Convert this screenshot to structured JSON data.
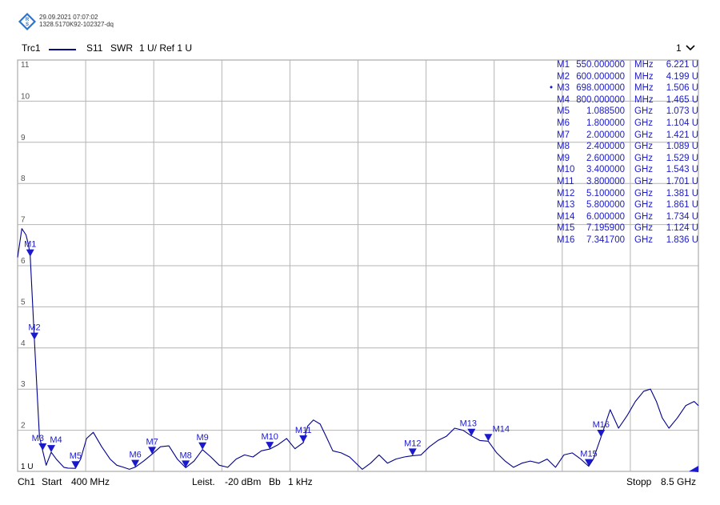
{
  "header": {
    "timestamp": "29.09.2021 07:07:02",
    "instrument_id": "1328.5170K92-102327-dq",
    "logo_icon": "rohde-schwarz-logo"
  },
  "trace": {
    "name": "Trc1",
    "parameter": "S11",
    "format": "SWR",
    "scale": "1 U/ Ref 1 U",
    "color": "#00008b",
    "channel_selector": "1"
  },
  "footer": {
    "channel": "Ch1",
    "start_label": "Start",
    "start_value": "400 MHz",
    "power_label": "Leist.",
    "power_value": "-20 dBm",
    "bw_label": "Bb",
    "bw_value": "1 kHz",
    "stop_label": "Stopp",
    "stop_value": "8.5 GHz"
  },
  "colors": {
    "trace": "#00008b",
    "marker": "#1a1acc",
    "grid": "#b4b4b4",
    "background": "#ffffff"
  },
  "markers": [
    {
      "name": "M1",
      "freq": "550.000000",
      "unit": "MHz",
      "value": "6.221",
      "vunit": "U",
      "active": false
    },
    {
      "name": "M2",
      "freq": "600.000000",
      "unit": "MHz",
      "value": "4.199",
      "vunit": "U",
      "active": false
    },
    {
      "name": "M3",
      "freq": "698.000000",
      "unit": "MHz",
      "value": "1.506",
      "vunit": "U",
      "active": true
    },
    {
      "name": "M4",
      "freq": "800.000000",
      "unit": "MHz",
      "value": "1.465",
      "vunit": "U",
      "active": false
    },
    {
      "name": "M5",
      "freq": "1.088500",
      "unit": "GHz",
      "value": "1.073",
      "vunit": "U",
      "active": false
    },
    {
      "name": "M6",
      "freq": "1.800000",
      "unit": "GHz",
      "value": "1.104",
      "vunit": "U",
      "active": false
    },
    {
      "name": "M7",
      "freq": "2.000000",
      "unit": "GHz",
      "value": "1.421",
      "vunit": "U",
      "active": false
    },
    {
      "name": "M8",
      "freq": "2.400000",
      "unit": "GHz",
      "value": "1.089",
      "vunit": "U",
      "active": false
    },
    {
      "name": "M9",
      "freq": "2.600000",
      "unit": "GHz",
      "value": "1.529",
      "vunit": "U",
      "active": false
    },
    {
      "name": "M10",
      "freq": "3.400000",
      "unit": "GHz",
      "value": "1.543",
      "vunit": "U",
      "active": false
    },
    {
      "name": "M11",
      "freq": "3.800000",
      "unit": "GHz",
      "value": "1.701",
      "vunit": "U",
      "active": false
    },
    {
      "name": "M12",
      "freq": "5.100000",
      "unit": "GHz",
      "value": "1.381",
      "vunit": "U",
      "active": false
    },
    {
      "name": "M13",
      "freq": "5.800000",
      "unit": "GHz",
      "value": "1.861",
      "vunit": "U",
      "active": false
    },
    {
      "name": "M14",
      "freq": "6.000000",
      "unit": "GHz",
      "value": "1.734",
      "vunit": "U",
      "active": false
    },
    {
      "name": "M15",
      "freq": "7.195900",
      "unit": "GHz",
      "value": "1.124",
      "vunit": "U",
      "active": false
    },
    {
      "name": "M16",
      "freq": "7.341700",
      "unit": "GHz",
      "value": "1.836",
      "vunit": "U",
      "active": false
    }
  ],
  "chart_data": {
    "type": "line",
    "xlim": [
      0.4,
      8.5
    ],
    "x_unit": "GHz",
    "ylim": [
      1,
      11
    ],
    "y_unit": "U",
    "y_ticks": [
      "11",
      "10",
      "9",
      "8",
      "7",
      "6",
      "5",
      "4",
      "3",
      "2",
      "1 U"
    ],
    "y_tick_values": [
      11,
      10,
      9,
      8,
      7,
      6,
      5,
      4,
      3,
      2,
      1
    ],
    "grid": true,
    "x_divisions": 10,
    "series": [
      {
        "x": [
          0.4,
          0.45,
          0.5,
          0.53,
          0.55,
          0.6,
          0.63,
          0.66,
          0.698,
          0.74,
          0.8,
          0.86,
          0.95,
          1.0,
          1.0885,
          1.15,
          1.22,
          1.3,
          1.4,
          1.5,
          1.58,
          1.66,
          1.73,
          1.8,
          1.9,
          2.0,
          2.1,
          2.2,
          2.3,
          2.4,
          2.5,
          2.6,
          2.7,
          2.8,
          2.9,
          3.0,
          3.1,
          3.2,
          3.3,
          3.4,
          3.5,
          3.6,
          3.7,
          3.8,
          3.85,
          3.92,
          4.0,
          4.07,
          4.15,
          4.25,
          4.35,
          4.5,
          4.6,
          4.7,
          4.8,
          4.9,
          5.0,
          5.1,
          5.2,
          5.3,
          5.4,
          5.5,
          5.6,
          5.7,
          5.8,
          5.9,
          6.0,
          6.1,
          6.2,
          6.3,
          6.4,
          6.5,
          6.6,
          6.7,
          6.8,
          6.9,
          7.0,
          7.1,
          7.195,
          7.25,
          7.3417,
          7.45,
          7.55,
          7.65,
          7.75,
          7.85,
          7.93,
          8.0,
          8.07,
          8.15,
          8.25,
          8.35,
          8.45,
          8.5
        ],
        "y": [
          6.2,
          6.9,
          6.75,
          6.5,
          6.221,
          4.199,
          3.0,
          1.85,
          1.506,
          1.15,
          1.465,
          1.3,
          1.1,
          1.08,
          1.073,
          1.3,
          1.8,
          1.95,
          1.6,
          1.3,
          1.15,
          1.1,
          1.05,
          1.104,
          1.25,
          1.421,
          1.6,
          1.62,
          1.3,
          1.089,
          1.25,
          1.529,
          1.35,
          1.15,
          1.1,
          1.3,
          1.4,
          1.35,
          1.5,
          1.543,
          1.65,
          1.8,
          1.55,
          1.701,
          2.1,
          2.25,
          2.15,
          1.85,
          1.5,
          1.45,
          1.35,
          1.05,
          1.2,
          1.4,
          1.2,
          1.3,
          1.35,
          1.381,
          1.4,
          1.6,
          1.75,
          1.85,
          2.05,
          2.0,
          1.861,
          1.75,
          1.734,
          1.45,
          1.25,
          1.1,
          1.2,
          1.25,
          1.2,
          1.3,
          1.1,
          1.4,
          1.45,
          1.3,
          1.124,
          1.3,
          1.836,
          2.5,
          2.05,
          2.35,
          2.7,
          2.95,
          3.0,
          2.7,
          2.3,
          2.05,
          2.3,
          2.6,
          2.7,
          2.6
        ]
      }
    ],
    "marker_points": [
      {
        "name": "M1",
        "x": 0.55,
        "y": 6.221
      },
      {
        "name": "M2",
        "x": 0.6,
        "y": 4.199
      },
      {
        "name": "M3",
        "x": 0.698,
        "y": 1.506
      },
      {
        "name": "M4",
        "x": 0.8,
        "y": 1.465
      },
      {
        "name": "M5",
        "x": 1.0885,
        "y": 1.073
      },
      {
        "name": "M6",
        "x": 1.8,
        "y": 1.104
      },
      {
        "name": "M7",
        "x": 2.0,
        "y": 1.421
      },
      {
        "name": "M8",
        "x": 2.4,
        "y": 1.089
      },
      {
        "name": "M9",
        "x": 2.6,
        "y": 1.529
      },
      {
        "name": "M10",
        "x": 3.4,
        "y": 1.543
      },
      {
        "name": "M11",
        "x": 3.8,
        "y": 1.701
      },
      {
        "name": "M12",
        "x": 5.1,
        "y": 1.381
      },
      {
        "name": "M13",
        "x": 5.8,
        "y": 1.861
      },
      {
        "name": "M14",
        "x": 6.0,
        "y": 1.734
      },
      {
        "name": "M15",
        "x": 7.1959,
        "y": 1.124
      },
      {
        "name": "M16",
        "x": 7.3417,
        "y": 1.836
      }
    ],
    "reference_level": 1
  }
}
